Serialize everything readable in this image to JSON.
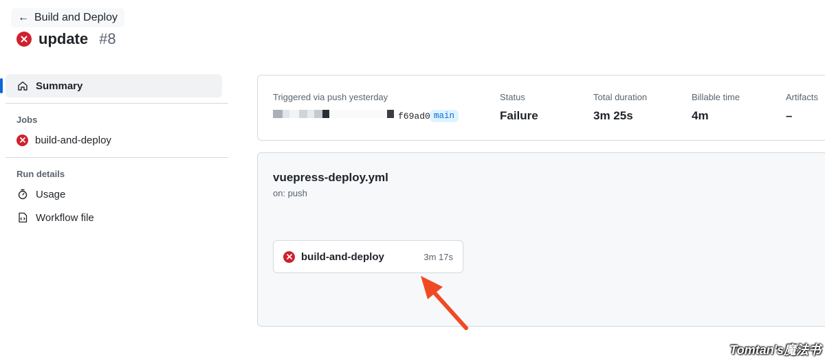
{
  "header": {
    "back_label": "Build and Deploy",
    "run_title": "update",
    "run_number": "#8"
  },
  "sidebar": {
    "summary_label": "Summary",
    "jobs_heading": "Jobs",
    "jobs": [
      {
        "label": "build-and-deploy",
        "status": "failure"
      }
    ],
    "run_details_heading": "Run details",
    "details": [
      {
        "label": "Usage",
        "icon": "stopwatch-icon"
      },
      {
        "label": "Workflow file",
        "icon": "file-code-icon"
      }
    ]
  },
  "summary": {
    "triggered_label": "Triggered via push yesterday",
    "commit_sha": "f69ad0",
    "branch": "main",
    "status_label": "Status",
    "status_value": "Failure",
    "duration_label": "Total duration",
    "duration_value": "3m 25s",
    "billable_label": "Billable time",
    "billable_value": "4m",
    "artifacts_label": "Artifacts",
    "artifacts_value": "–"
  },
  "workflow": {
    "file_name": "vuepress-deploy.yml",
    "trigger": "on: push",
    "job_name": "build-and-deploy",
    "job_time": "3m 17s"
  },
  "watermark": "Tomtan's魔法书",
  "colors": {
    "failure_red": "#cf222e",
    "accent_blue": "#0969da",
    "annotation_arrow": "#f04a24"
  }
}
